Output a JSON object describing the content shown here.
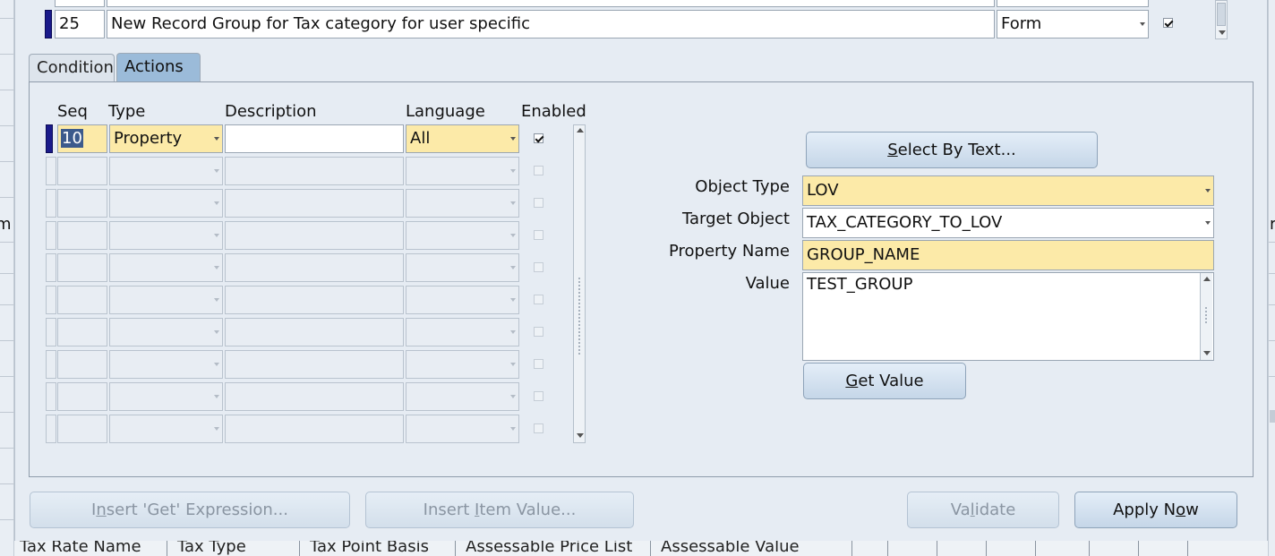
{
  "top_row": {
    "seq": "25",
    "description": "New Record Group for Tax category for user specific",
    "level": "Form",
    "enabled": true
  },
  "tabs": [
    {
      "label": "Condition",
      "active": false
    },
    {
      "label": "Actions",
      "active": true
    }
  ],
  "actions_table": {
    "headers": {
      "seq": "Seq",
      "type": "Type",
      "description": "Description",
      "language": "Language",
      "enabled": "Enabled"
    },
    "rows": [
      {
        "seq": "10",
        "type": "Property",
        "description": "",
        "language": "All",
        "enabled": true
      }
    ],
    "empty_rows": 9
  },
  "select_by_text": {
    "prefix": "",
    "mnemonic": "S",
    "rest": "elect By Text..."
  },
  "properties": {
    "object_type": {
      "label": "Object Type",
      "value": "LOV"
    },
    "target_object": {
      "label": "Target Object",
      "value": "TAX_CATEGORY_TO_LOV"
    },
    "property_name": {
      "label": "Property Name",
      "value": "GROUP_NAME"
    },
    "value": {
      "label": "Value",
      "value": "TEST_GROUP"
    }
  },
  "get_value": {
    "prefix": "",
    "mnemonic": "G",
    "rest": "et Value"
  },
  "footer": {
    "insert_get": {
      "prefix": "I",
      "mnemonic": "n",
      "rest": "sert 'Get' Expression..."
    },
    "insert_item": {
      "prefix": "Insert ",
      "mnemonic": "I",
      "rest": "tem Value..."
    },
    "validate": {
      "prefix": "Va",
      "mnemonic": "l",
      "rest": "idate"
    },
    "apply_now": {
      "prefix": "Apply N",
      "mnemonic": "o",
      "rest": "w"
    }
  },
  "background": {
    "bottom_labels": [
      "Tax Rate Name",
      "Tax Type",
      "Tax Point Basis",
      "Assessable Price List",
      "Assessable Value"
    ],
    "left_fragment": "m",
    "right_fragment": "r"
  },
  "colors": {
    "required_field": "#fceaa8",
    "active_tab": "#9bbbd9",
    "row_indicator": "#1a1a8a"
  }
}
